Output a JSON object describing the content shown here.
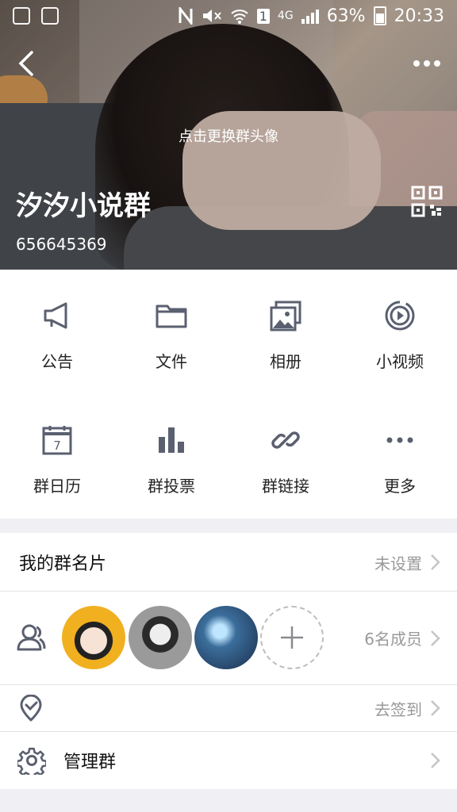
{
  "status_bar": {
    "battery": "63%",
    "time": "20:33",
    "network": "4G",
    "sim_slot": "1"
  },
  "header": {
    "change_avatar_hint": "点击更换群头像",
    "group_name": "汐汐小说群",
    "group_id": "656645369"
  },
  "grid": [
    {
      "label": "公告",
      "icon": "megaphone-icon"
    },
    {
      "label": "文件",
      "icon": "folder-icon"
    },
    {
      "label": "相册",
      "icon": "album-icon"
    },
    {
      "label": "小视频",
      "icon": "video-icon"
    },
    {
      "label": "群日历",
      "icon": "calendar-icon"
    },
    {
      "label": "群投票",
      "icon": "vote-icon"
    },
    {
      "label": "群链接",
      "icon": "link-icon"
    },
    {
      "label": "更多",
      "icon": "more-icon"
    }
  ],
  "calendar_day": "7",
  "card": {
    "label": "我的群名片",
    "value": "未设置"
  },
  "members": {
    "count_label": "6名成员"
  },
  "checkin": {
    "value": "去签到"
  },
  "manage": {
    "label": "管理群"
  },
  "colors": {
    "icon_gray": "#5b6070",
    "text_dark": "#111111",
    "text_muted": "#999999",
    "background": "#efeff4"
  }
}
